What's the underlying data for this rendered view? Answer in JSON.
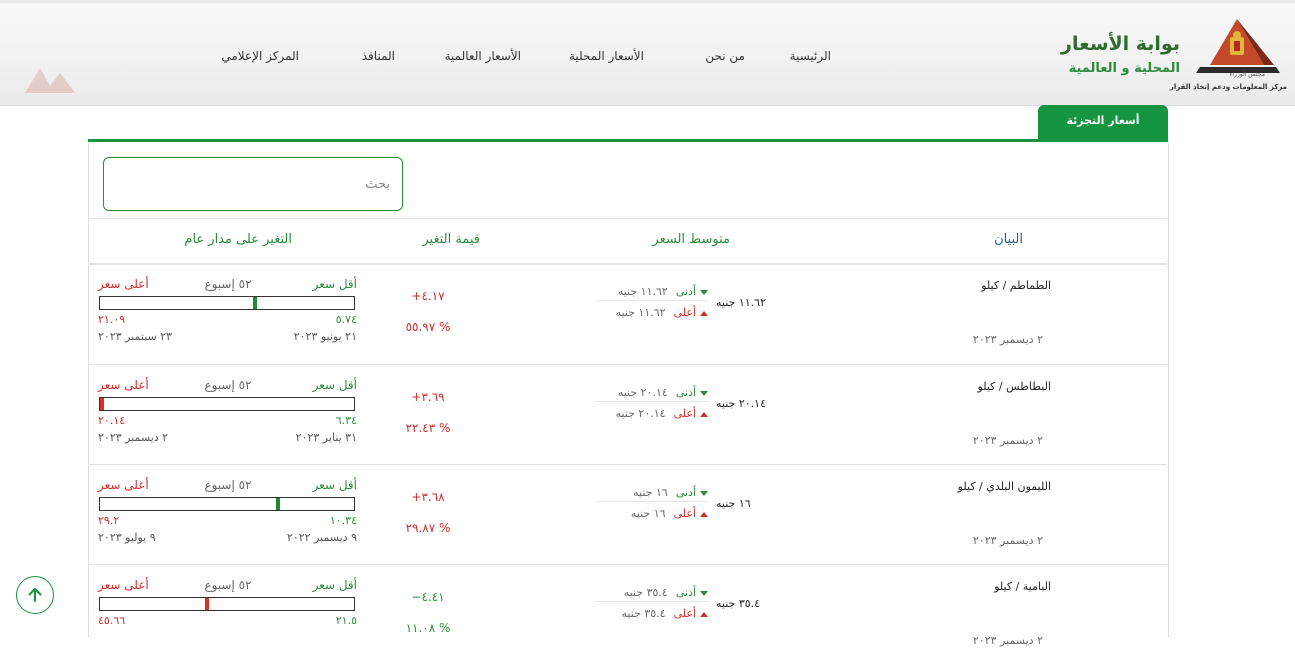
{
  "header": {
    "logo_title": "بوابة الأسعار",
    "logo_subtitle": "المحلية و العالمية",
    "council": "مجلس الوزراء",
    "center": "مركز المعلومات ودعم إتخاذ القرار"
  },
  "nav": {
    "items": [
      {
        "label": "الرئيسية"
      },
      {
        "label": "من نحن"
      },
      {
        "label": "الأسعار المحلية"
      },
      {
        "label": "الأسعار العالمية"
      },
      {
        "label": "المنافذ"
      },
      {
        "label": "المركز الإعلامي"
      }
    ]
  },
  "tab": {
    "label": "أسعار التجزئة"
  },
  "search": {
    "placeholder": "بحث",
    "value": ""
  },
  "table": {
    "headers": {
      "item": "البيان",
      "avg": "متوسط السعر",
      "change": "قيمة التغير",
      "yearly": "التغير على مدار عام"
    },
    "labels": {
      "min": "أدنى",
      "max": "أعلى",
      "low": "أقل سعر",
      "high": "أعلى سعر",
      "week52": "٥٢ إسبوع"
    },
    "rows": [
      {
        "name": "الطماطم / كيلو",
        "date": "٢ ديسمبر ٢٠٢٣",
        "avg": "١١.٦٢ جنيه",
        "min": "١١.٦٢ جنيه",
        "max": "١١.٦٢ جنيه",
        "change": "٤.١٧+",
        "pct": "% ٥٥.٩٧",
        "dir": "up",
        "low_val": "٥.٧٤",
        "high_val": "٢١.٠٩",
        "low_date": "٢١ يونيو ٢٠٢٣",
        "high_date": "٢٣ سبتمبر ٢٠٢٣",
        "position": 0.39
      },
      {
        "name": "البطاطس / كيلو",
        "date": "٢ ديسمبر ٢٠٢٣",
        "avg": "٢٠.١٤ جنيه",
        "min": "٢٠.١٤ جنيه",
        "max": "٢٠.١٤ جنيه",
        "change": "٣.٦٩+",
        "pct": "% ٢٢.٤٣",
        "dir": "up",
        "low_val": "٦.٣٤",
        "high_val": "٢٠.١٤",
        "low_date": "٣١ يناير ٢٠٢٣",
        "high_date": "٢ ديسمبر ٢٠٢٣",
        "position": 1.0
      },
      {
        "name": "الليمون البلدي / كيلو",
        "date": "٢ ديسمبر ٢٠٢٣",
        "avg": "١٦ جنيه",
        "min": "١٦ جنيه",
        "max": "١٦ جنيه",
        "change": "٣.٦٨+",
        "pct": "% ٢٩.٨٧",
        "dir": "up",
        "low_val": "١٠.٣٤",
        "high_val": "٢٩.٢",
        "low_date": "٩ ديسمبر ٢٠٢٢",
        "high_date": "٩ يوليو ٢٠٢٣",
        "position": 0.3
      },
      {
        "name": "البامية / كيلو",
        "date": "٢ ديسمبر ٢٠٢٣",
        "avg": "٣٥.٤ جنيه",
        "min": "٣٥.٤ جنيه",
        "max": "٣٥.٤ جنيه",
        "change": "٤.٤١−",
        "pct": "% ١١.٠٨",
        "dir": "down",
        "low_val": "٢١.٥",
        "high_val": "٤٥.٦٦",
        "low_date": "",
        "high_date": "",
        "position": 0.58
      }
    ]
  },
  "colors": {
    "brand_green": "#169541",
    "up_red": "#c9302c",
    "down_green": "#2e8b3e",
    "marker_green": "#1f8a3a",
    "marker_red": "#d9302c"
  },
  "icons": {
    "scroll_top": "arrow-up-icon",
    "logo": "pyramid-eagle-icon"
  }
}
